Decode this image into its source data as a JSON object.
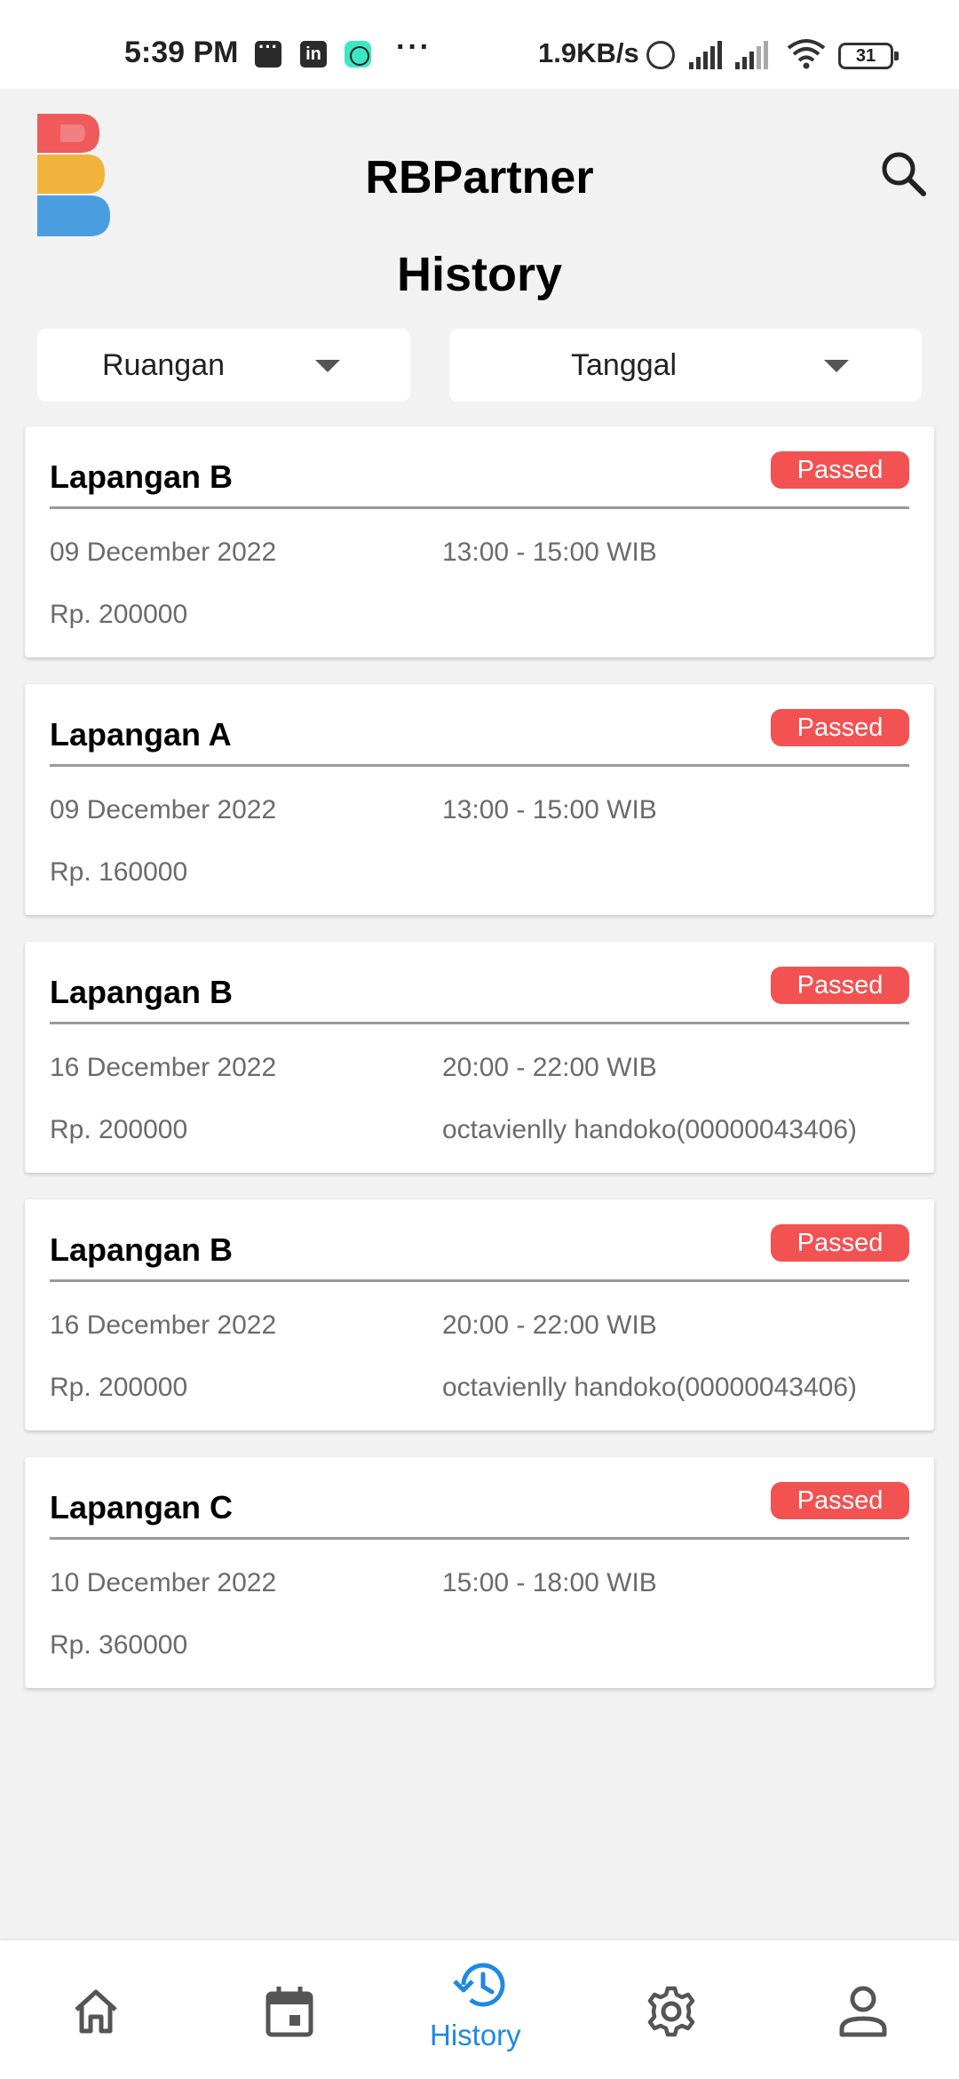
{
  "status_bar": {
    "time": "5:39 PM",
    "net_speed": "1.9KB/s",
    "battery": "31",
    "linkedin": "in",
    "more": "···"
  },
  "header": {
    "logo_letters": "RB",
    "app_title": "RBPartner",
    "page_title": "History"
  },
  "filters": {
    "room": "Ruangan",
    "date": "Tanggal"
  },
  "bookings": [
    {
      "venue": "Lapangan B",
      "status": "Passed",
      "date": "09 December 2022",
      "time": "13:00 - 15:00 WIB",
      "price": "Rp. 200000",
      "user": ""
    },
    {
      "venue": "Lapangan A",
      "status": "Passed",
      "date": "09 December 2022",
      "time": "13:00 - 15:00 WIB",
      "price": "Rp. 160000",
      "user": ""
    },
    {
      "venue": "Lapangan B",
      "status": "Passed",
      "date": "16 December 2022",
      "time": "20:00 - 22:00 WIB",
      "price": "Rp. 200000",
      "user": "octavienlly handoko(00000043406)"
    },
    {
      "venue": "Lapangan B",
      "status": "Passed",
      "date": "16 December 2022",
      "time": "20:00 - 22:00 WIB",
      "price": "Rp. 200000",
      "user": "octavienlly handoko(00000043406)"
    },
    {
      "venue": "Lapangan C",
      "status": "Passed",
      "date": "10 December 2022",
      "time": "15:00 - 18:00 WIB",
      "price": "Rp. 360000",
      "user": ""
    }
  ],
  "nav": {
    "active": "History",
    "items": [
      {
        "icon": "home-icon"
      },
      {
        "icon": "calendar-icon"
      },
      {
        "icon": "history-icon",
        "label": "History"
      },
      {
        "icon": "gear-icon"
      },
      {
        "icon": "profile-icon"
      }
    ]
  },
  "colors": {
    "accent": "#1e88e5",
    "badge": "#f25252",
    "logo_red": "#f05a5a",
    "logo_yellow": "#f2b33d",
    "logo_blue": "#4a9ee0"
  }
}
